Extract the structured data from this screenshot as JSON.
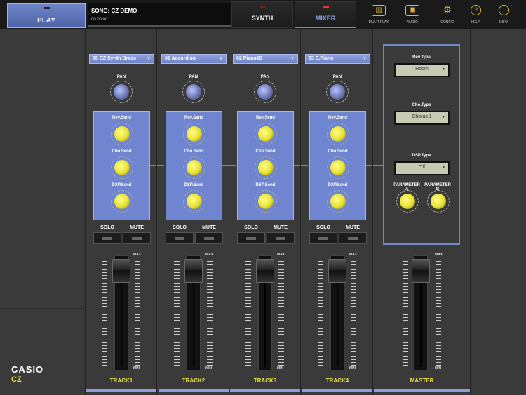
{
  "header": {
    "play_label": "PLAY",
    "song_name": "SONG: CZ DEMO",
    "song_time": "00:00:00",
    "synth_label": "SYNTH",
    "mixer_label": "MIXER",
    "tools": [
      {
        "label": "MULTI PLAY",
        "icon": "keyboard-icon"
      },
      {
        "label": "AUDIO",
        "icon": "cassette-icon"
      },
      {
        "label": "CONFIG",
        "icon": "gear-icon"
      },
      {
        "label": "HELP",
        "icon": "help-icon"
      },
      {
        "label": "INFO",
        "icon": "info-icon"
      }
    ]
  },
  "brand": {
    "name": "CASIO",
    "model": "CZ"
  },
  "tracks": [
    {
      "preset": "00 CZ Synth Brass",
      "name": "TRACK1"
    },
    {
      "preset": "01 Accordion",
      "name": "TRACK2"
    },
    {
      "preset": "02 Piano16",
      "name": "TRACK3"
    },
    {
      "preset": "03 E.Piano",
      "name": "TRACK4"
    }
  ],
  "strip_labels": {
    "pan": "PAN",
    "rev_send": "Rev.Send",
    "cho_send": "Cho.Send",
    "dsp_send": "DSP.Send",
    "solo": "SOLO",
    "mute": "MUTE",
    "max": "MAX",
    "min": "MIN"
  },
  "master": {
    "rev_type_label": "Rev.Type",
    "rev_type_value": "Room",
    "cho_type_label": "Cho.Type",
    "cho_type_value": "Chorus 1",
    "dsp_type_label": "DSP.Type",
    "dsp_type_value": "Off",
    "param_a": "PARAMETER A",
    "param_b": "PARAMETER B",
    "name": "MASTER"
  },
  "colors": {
    "accent": "#6f86c8",
    "track_name": "#e8e03c",
    "knob": "#e8e030"
  }
}
